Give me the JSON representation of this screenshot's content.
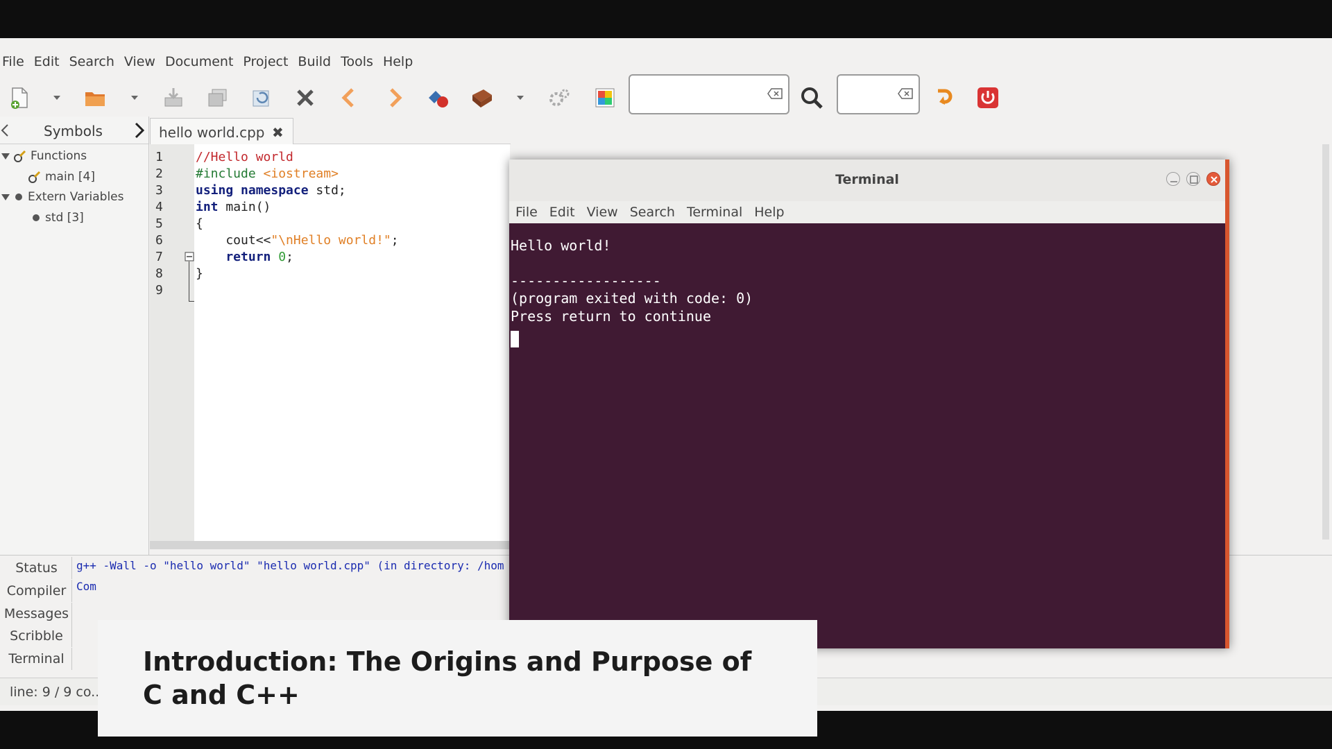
{
  "ide": {
    "menu": [
      "File",
      "Edit",
      "Search",
      "View",
      "Document",
      "Project",
      "Build",
      "Tools",
      "Help"
    ],
    "sidebar": {
      "tab_label": "Symbols",
      "tree": [
        {
          "label": "Functions",
          "level": 0,
          "expanded": true
        },
        {
          "label": "main [4]",
          "level": 1
        },
        {
          "label": "Extern Variables",
          "level": 0,
          "expanded": true
        },
        {
          "label": "std [3]",
          "level": 1
        }
      ]
    },
    "editor": {
      "tab_title": "hello world.cpp",
      "close_glyph": "✖",
      "line_numbers": [
        "1",
        "2",
        "3",
        "4",
        "5",
        "6",
        "7",
        "8",
        "9"
      ],
      "code": {
        "l1": "//Hello world",
        "l2_pre": "#include ",
        "l2_inc": "<iostream>",
        "l3_kw": "using namespace",
        "l3_rest": " std;",
        "l4_kw": "int",
        "l4_rest": " main()",
        "l5": "{",
        "l6_a": "    cout<<",
        "l6_str": "\"\\nHello world!\"",
        "l6_b": ";",
        "l7_kw": "    return",
        "l7_num": " 0",
        "l7_b": ";",
        "l8": "}"
      }
    },
    "bottom_tabs": [
      "Status",
      "Compiler",
      "Messages",
      "Scribble",
      "Terminal"
    ],
    "compiler_message": "g++ -Wall -o \"hello world\" \"hello world.cpp\" (in directory: /hom",
    "compiler_message2": "Com",
    "statusbar": "line: 9 / 9    co..."
  },
  "terminal": {
    "title": "Terminal",
    "menu": [
      "File",
      "Edit",
      "View",
      "Search",
      "Terminal",
      "Help"
    ],
    "lines": [
      "Hello world!",
      "",
      "------------------",
      "(program exited with code: 0)",
      "Press return to continue"
    ]
  },
  "caption": {
    "text": "Introduction: The Origins and Purpose of C and C++"
  },
  "colors": {
    "terminal_bg": "#401a33",
    "terminal_accent": "#d8562e",
    "ide_bg": "#f2f1f0"
  },
  "icons": [
    "new-file-icon",
    "open-file-icon",
    "save-icon",
    "save-all-icon",
    "revert-icon",
    "close-icon",
    "back-icon",
    "forward-icon",
    "compile-icon",
    "build-icon",
    "preferences-icon",
    "color-chooser-icon",
    "search-icon",
    "jump-to-line-icon",
    "quit-icon"
  ]
}
